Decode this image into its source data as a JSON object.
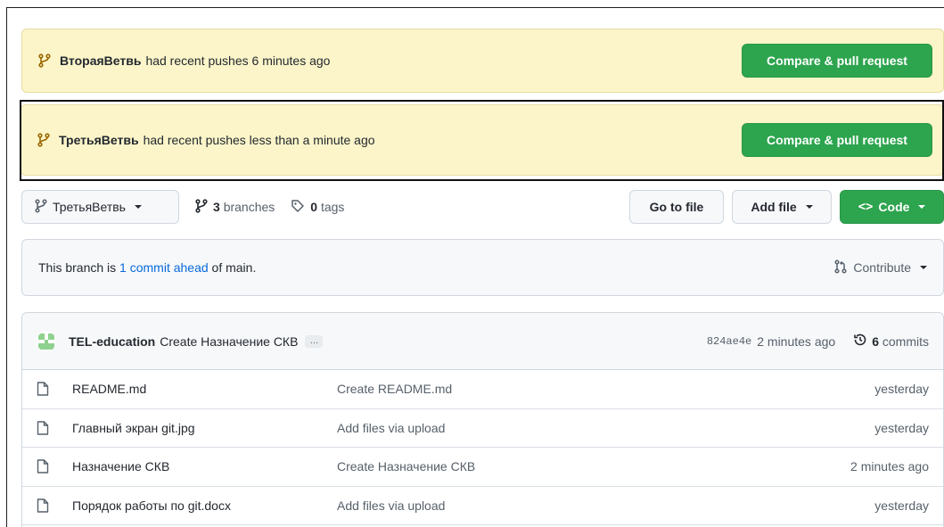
{
  "banners": [
    {
      "branch": "ВтораяВетвь",
      "text": "had recent pushes 6 minutes ago",
      "button": "Compare & pull request"
    },
    {
      "branch": "ТретьяВетвь",
      "text": "had recent pushes less than a minute ago",
      "button": "Compare & pull request"
    }
  ],
  "toolbar": {
    "branch_select": "ТретьяВетвь",
    "branches_count": "3",
    "branches_label": "branches",
    "tags_count": "0",
    "tags_label": "tags",
    "go_to_file": "Go to file",
    "add_file": "Add file",
    "code": "Code"
  },
  "ahead": {
    "prefix": "This branch is",
    "link": "1 commit ahead",
    "suffix": "of main.",
    "contribute": "Contribute"
  },
  "latest_commit": {
    "author": "TEL-education",
    "message": "Create Назначение СКВ",
    "ellipsis": "…",
    "sha": "824ae4e",
    "time": "2 minutes ago",
    "commits_count": "6",
    "commits_label": "commits"
  },
  "files": [
    {
      "name": "README.md",
      "message": "Create README.md",
      "date": "yesterday"
    },
    {
      "name": "Главный экран git.jpg",
      "message": "Add files via upload",
      "date": "yesterday"
    },
    {
      "name": "Назначение СКВ",
      "message": "Create Назначение СКВ",
      "date": "2 minutes ago"
    },
    {
      "name": "Порядок работы по git.docx",
      "message": "Add files via upload",
      "date": "yesterday"
    }
  ],
  "colors": {
    "accent_green": "#2da44e",
    "banner_bg": "#fbf5c9",
    "link_blue": "#0969da"
  }
}
